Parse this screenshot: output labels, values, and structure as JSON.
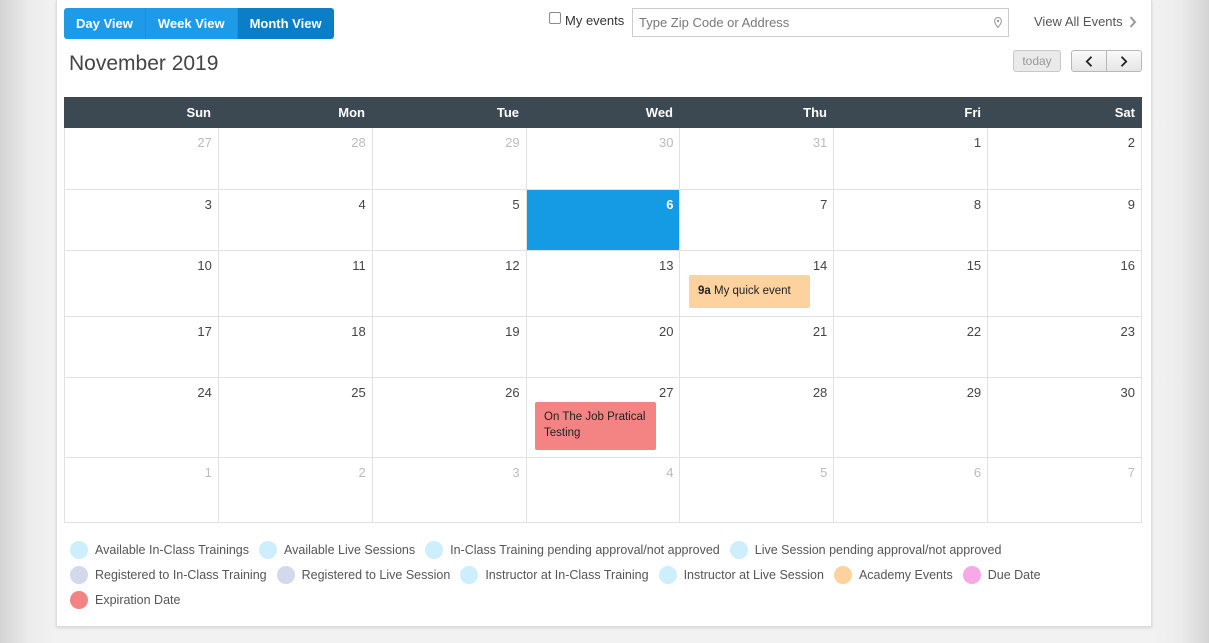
{
  "views": [
    {
      "label": "Day View",
      "active": false
    },
    {
      "label": "Week View",
      "active": false
    },
    {
      "label": "Month View",
      "active": true
    }
  ],
  "filters": {
    "my_events_label": "My events",
    "my_events_checked": false,
    "search_placeholder": "Type Zip Code or Address",
    "search_value": "",
    "view_all_label": "View All Events"
  },
  "calendar": {
    "title": "November 2019",
    "today_label": "today",
    "weekdays": [
      "Sun",
      "Mon",
      "Tue",
      "Wed",
      "Thu",
      "Fri",
      "Sat"
    ],
    "weeks": [
      [
        {
          "d": "27",
          "other": true
        },
        {
          "d": "28",
          "other": true
        },
        {
          "d": "29",
          "other": true
        },
        {
          "d": "30",
          "other": true
        },
        {
          "d": "31",
          "other": true
        },
        {
          "d": "1"
        },
        {
          "d": "2"
        }
      ],
      [
        {
          "d": "3"
        },
        {
          "d": "4"
        },
        {
          "d": "5"
        },
        {
          "d": "6",
          "today": true
        },
        {
          "d": "7"
        },
        {
          "d": "8"
        },
        {
          "d": "9"
        }
      ],
      [
        {
          "d": "10"
        },
        {
          "d": "11"
        },
        {
          "d": "12"
        },
        {
          "d": "13"
        },
        {
          "d": "14"
        },
        {
          "d": "15"
        },
        {
          "d": "16"
        }
      ],
      [
        {
          "d": "17"
        },
        {
          "d": "18"
        },
        {
          "d": "19"
        },
        {
          "d": "20"
        },
        {
          "d": "21"
        },
        {
          "d": "22"
        },
        {
          "d": "23"
        }
      ],
      [
        {
          "d": "24"
        },
        {
          "d": "25"
        },
        {
          "d": "26"
        },
        {
          "d": "27"
        },
        {
          "d": "28"
        },
        {
          "d": "29"
        },
        {
          "d": "30"
        }
      ],
      [
        {
          "d": "1",
          "other": true
        },
        {
          "d": "2",
          "other": true
        },
        {
          "d": "3",
          "other": true
        },
        {
          "d": "4",
          "other": true
        },
        {
          "d": "5",
          "other": true
        },
        {
          "d": "6",
          "other": true
        },
        {
          "d": "7",
          "other": true
        }
      ]
    ],
    "events": {
      "quick": {
        "time": "9a",
        "title": "My quick event",
        "color": "#fdd29f"
      },
      "ojt": {
        "title": "On The Job Pratical Testing",
        "color": "#f48484"
      }
    }
  },
  "legend": [
    [
      {
        "label": "Available In-Class Trainings",
        "color": "#cdeefc"
      },
      {
        "label": "Available Live Sessions",
        "color": "#cdeefc"
      },
      {
        "label": "In-Class Training pending approval/not approved",
        "color": "#cdeefc"
      },
      {
        "label": "Live Session pending approval/not approved",
        "color": "#cdeefc"
      }
    ],
    [
      {
        "label": "Registered to In-Class Training",
        "color": "#d3d8ea"
      },
      {
        "label": "Registered to Live Session",
        "color": "#d3d8ea"
      },
      {
        "label": "Instructor at In-Class Training",
        "color": "#cdeefc"
      },
      {
        "label": "Instructor at Live Session",
        "color": "#cdeefc"
      },
      {
        "label": "Academy Events",
        "color": "#fdd29f"
      },
      {
        "label": "Due Date",
        "color": "#f7a8e6"
      }
    ],
    [
      {
        "label": "Expiration Date",
        "color": "#f48484"
      }
    ]
  ]
}
